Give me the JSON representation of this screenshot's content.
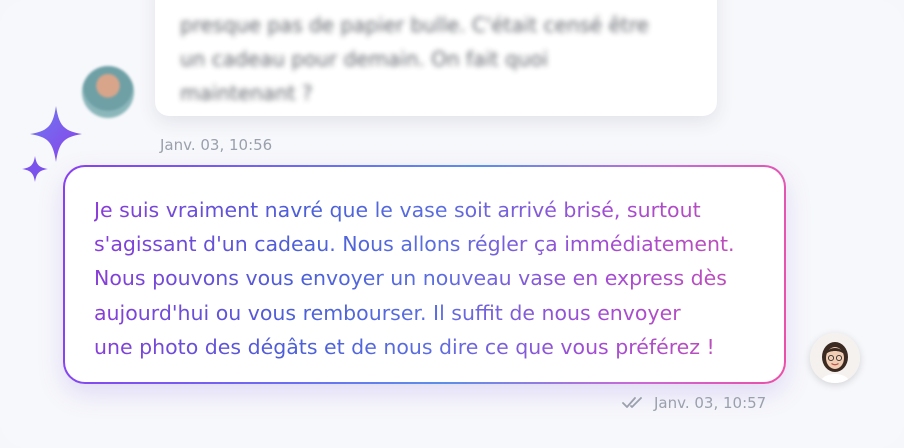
{
  "incoming": {
    "lines": [
      "presque pas de papier bulle. C'était censé être",
      "un cadeau pour demain. On fait quoi",
      "maintenant ?"
    ],
    "timestamp": "Janv. 03, 10:56"
  },
  "outgoing": {
    "lines": [
      "Je suis vraiment navré que le vase soit arrivé brisé, surtout",
      "s'agissant d'un cadeau. Nous allons régler ça immédiatement.",
      "Nous pouvons vous envoyer un nouveau vase en express dès",
      "aujourd'hui ou vous rembourser. Il suffit de nous envoyer",
      "une photo des dégâts et de nous dire ce que vous préférez !"
    ],
    "timestamp": "Janv. 03, 10:57",
    "status_icon": "double-check-icon"
  },
  "colors": {
    "gradient_start": "#8a3ff0",
    "gradient_mid": "#5b8fe8",
    "gradient_end": "#ec4fa6"
  },
  "icons": [
    "sparkle-icon",
    "double-check-icon"
  ]
}
